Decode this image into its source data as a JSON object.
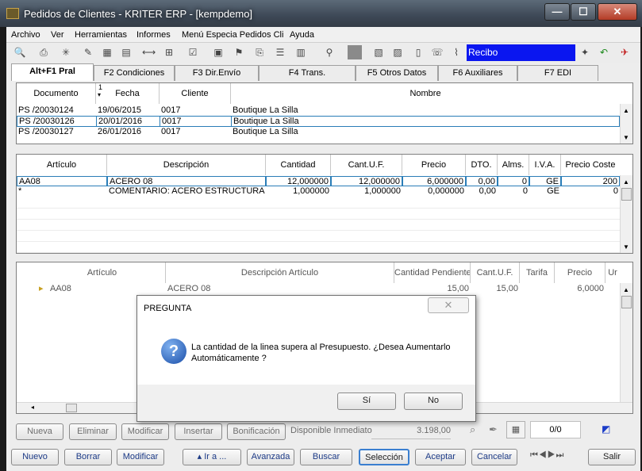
{
  "window": {
    "title": "Pedidos de Clientes - KRITER ERP - [kempdemo]"
  },
  "menu": [
    "Archivo",
    "Ver",
    "Herramientas",
    "Informes",
    "Menú Especia Pedidos Cli",
    "Ayuda"
  ],
  "toolbar": {
    "document_type": "Recibo"
  },
  "tabs": [
    "Alt+F1 Pral",
    "F2 Condiciones",
    "F3 Dir.Envío",
    "F4 Trans.",
    "F5 Otros Datos",
    "F6 Auxiliares",
    "F7 EDI"
  ],
  "documents": {
    "headers": {
      "documento": "Documento",
      "sort": "1",
      "fecha": "Fecha",
      "cliente": "Cliente",
      "nombre": "Nombre"
    },
    "rows": [
      {
        "documento": "PS /20030124",
        "fecha": "19/06/2015",
        "cliente": "0017",
        "nombre": "Boutique La Silla"
      },
      {
        "documento": "PS /20030126",
        "fecha": "20/01/2016",
        "cliente": "0017",
        "nombre": "Boutique La Silla"
      },
      {
        "documento": "PS /20030127",
        "fecha": "26/01/2016",
        "cliente": "0017",
        "nombre": "Boutique La Silla"
      }
    ]
  },
  "lines": {
    "headers": {
      "articulo": "Artículo",
      "descripcion": "Descripción",
      "cantidad": "Cantidad",
      "cant_uf": "Cant.U.F.",
      "precio": "Precio",
      "dto": "DTO.",
      "alms": "Alms.",
      "iva": "I.V.A.",
      "coste": "Precio Coste"
    },
    "rows": [
      {
        "articulo": "AA08",
        "descripcion": "ACERO 08",
        "cantidad": "12,000000",
        "cant_uf": "12,000000",
        "precio": "6,000000",
        "dto": "0,00",
        "alms": "0",
        "iva": "GE",
        "coste": "200"
      },
      {
        "articulo": "*",
        "descripcion": "COMENTARIO: ACERO ESTRUCTURA",
        "cantidad": "1,000000",
        "cant_uf": "1,000000",
        "precio": "0,000000",
        "dto": "0,00",
        "alms": "0",
        "iva": "GE",
        "coste": "0"
      }
    ]
  },
  "pending": {
    "headers": {
      "articulo": "Artículo",
      "descripcion": "Descripción Artículo",
      "cantidad": "Cantidad Pendiente",
      "cant_uf": "Cant.U.F.",
      "tarifa": "Tarifa",
      "precio": "Precio",
      "ur": "Ur"
    },
    "rows": [
      {
        "articulo": "AA08",
        "descripcion": "ACERO 08",
        "cantidad": "15,00",
        "cant_uf": "15,00",
        "tarifa": "",
        "precio": "6,0000"
      }
    ]
  },
  "line_buttons": {
    "nueva": "Nueva",
    "eliminar": "Eliminar",
    "modificar": "Modificar",
    "insertar": "Insertar",
    "bonificacion": "Bonificación",
    "disponible_label": "Disponible Inmediato",
    "disponible_value": "3.198,00",
    "counter": "0/0"
  },
  "bottom_buttons": {
    "nuevo": "Nuevo",
    "borrar": "Borrar",
    "modificar": "Modificar",
    "ir_a": "Ir a ...",
    "avanzada": "Avanzada",
    "buscar": "Buscar",
    "seleccion": "Selección",
    "aceptar": "Aceptar",
    "cancelar": "Cancelar",
    "salir": "Salir"
  },
  "dialog": {
    "title": "PREGUNTA",
    "message": "La cantidad de la linea supera al Presupuesto. ¿Desea Aumentarlo Automáticamente ?",
    "yes": "Sí",
    "no": "No"
  },
  "colors": {
    "accent": "#0a16f0",
    "titlebar": "#3d4856",
    "selection_border": "#2a7db7"
  }
}
